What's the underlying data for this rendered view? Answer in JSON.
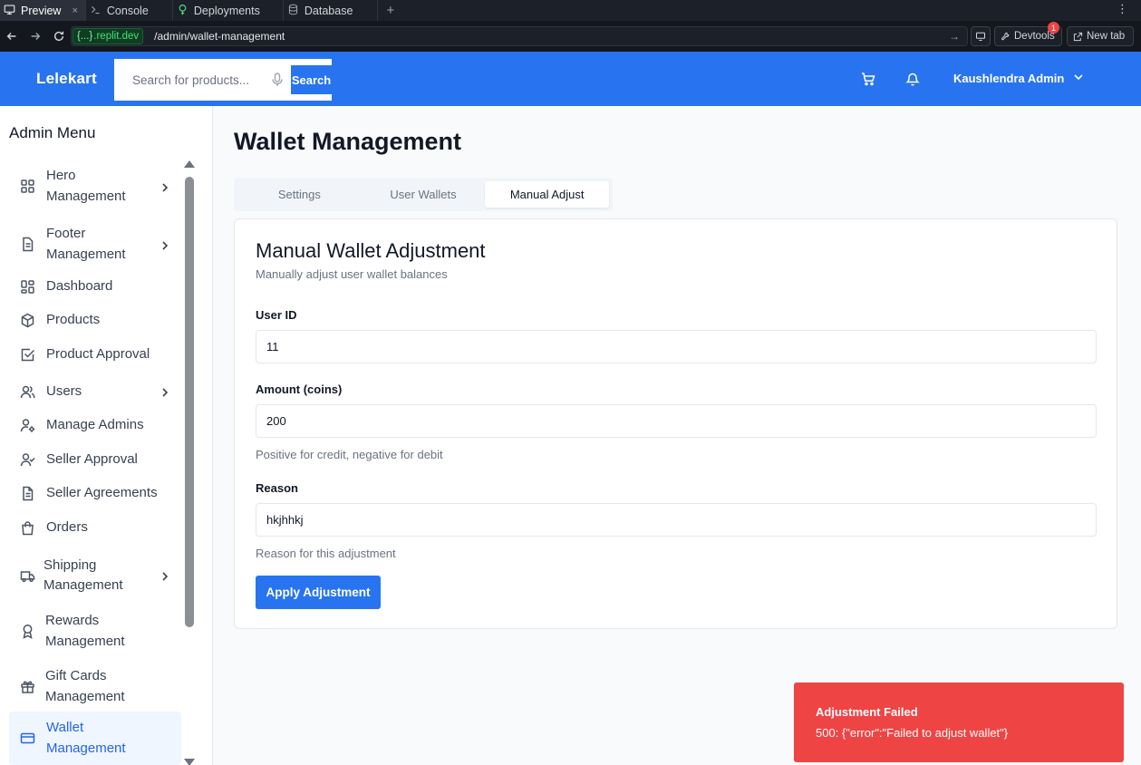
{
  "browser": {
    "tabs": [
      {
        "label": "Preview",
        "icon": "monitor-icon",
        "active": true,
        "close": "×"
      },
      {
        "label": "Console",
        "icon": "terminal-icon"
      },
      {
        "label": "Deployments",
        "icon": "deploy-icon"
      },
      {
        "label": "Database",
        "icon": "database-icon"
      }
    ],
    "new_tab_symbol": "+",
    "menu_symbol": "⋮",
    "domain_braces": "{...}",
    "domain": ".replit.dev",
    "path": "/admin/wallet-management",
    "go_symbol": "→",
    "devtools_label": "Devtools",
    "devtools_badge": "1",
    "new_tab_label": "New tab"
  },
  "header": {
    "logo": "Lelekart",
    "search_placeholder": "Search for products...",
    "search_button": "Search",
    "user_name": "Kaushlendra Admin"
  },
  "sidebar": {
    "title": "Admin Menu",
    "items": [
      {
        "label": "Hero Management",
        "icon": "grid-icon",
        "has_submenu": true
      },
      {
        "label": "Footer Management",
        "icon": "document-icon",
        "has_submenu": true
      },
      {
        "label": "Dashboard",
        "icon": "dashboard-icon",
        "has_submenu": false
      },
      {
        "label": "Products",
        "icon": "package-icon",
        "has_submenu": false
      },
      {
        "label": "Product Approval",
        "icon": "check-square-icon",
        "has_submenu": false
      },
      {
        "label": "Users",
        "icon": "users-icon",
        "has_submenu": true
      },
      {
        "label": "Manage Admins",
        "icon": "user-cog-icon",
        "has_submenu": false
      },
      {
        "label": "Seller Approval",
        "icon": "user-check-icon",
        "has_submenu": false
      },
      {
        "label": "Seller Agreements",
        "icon": "file-text-icon",
        "has_submenu": false
      },
      {
        "label": "Orders",
        "icon": "shopping-bag-icon",
        "has_submenu": false
      },
      {
        "label": "Shipping Management",
        "icon": "truck-icon",
        "has_submenu": true
      },
      {
        "label": "Rewards Management",
        "icon": "award-icon",
        "has_submenu": false
      },
      {
        "label": "Gift Cards Management",
        "icon": "gift-icon",
        "has_submenu": false
      },
      {
        "label": "Wallet Management",
        "icon": "credit-card-icon",
        "has_submenu": false,
        "active": true
      }
    ]
  },
  "main": {
    "title": "Wallet Management",
    "tabs": [
      {
        "label": "Settings",
        "active": false
      },
      {
        "label": "User Wallets",
        "active": false
      },
      {
        "label": "Manual Adjust",
        "active": true
      }
    ],
    "card": {
      "title": "Manual Wallet Adjustment",
      "description": "Manually adjust user wallet balances",
      "user_id_label": "User ID",
      "user_id_value": "11",
      "amount_label": "Amount (coins)",
      "amount_value": "200",
      "amount_hint": "Positive for credit, negative for debit",
      "reason_label": "Reason",
      "reason_value": "hkjhhkj",
      "reason_hint": "Reason for this adjustment",
      "apply_button": "Apply Adjustment"
    }
  },
  "toast": {
    "title": "Adjustment Failed",
    "message": "500: {\"error\":\"Failed to adjust wallet\"}"
  },
  "colors": {
    "brand": "#2874f0",
    "error": "#ef4444",
    "active_bg": "#eff6ff",
    "active_text": "#2563eb"
  }
}
